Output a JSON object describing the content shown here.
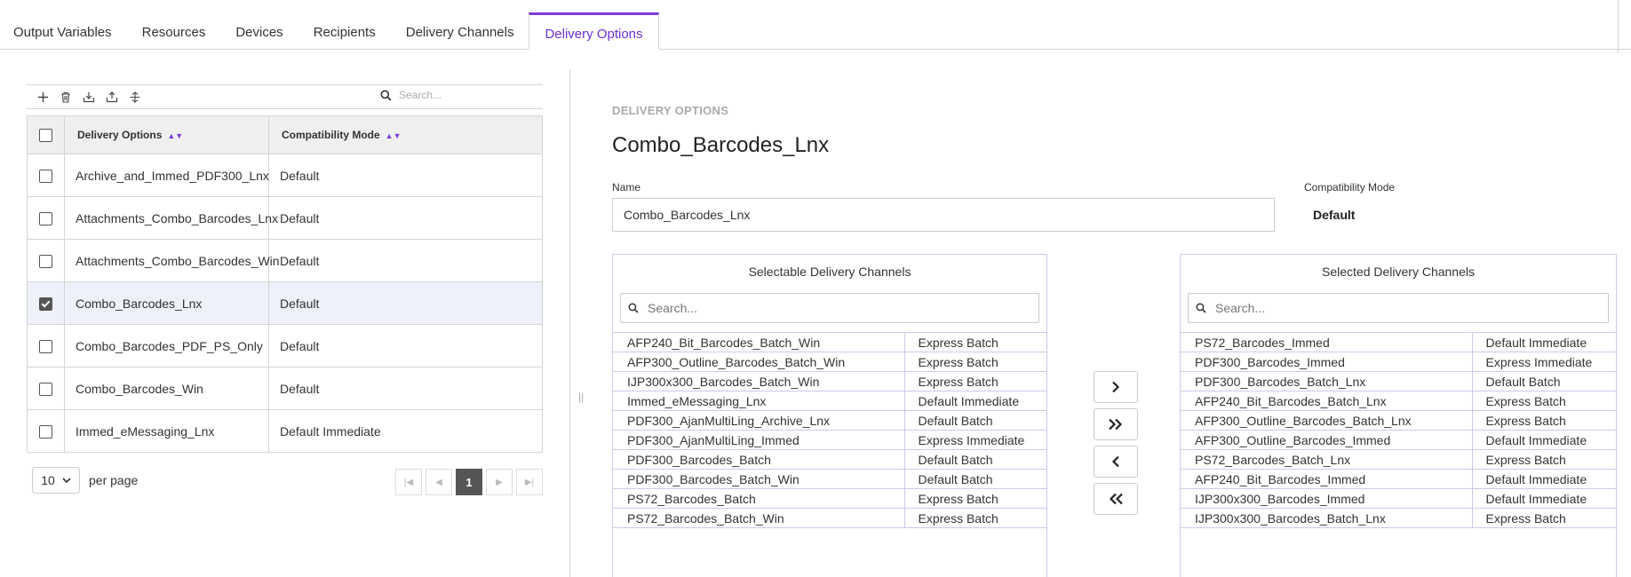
{
  "tabs": [
    {
      "label": "Output Variables",
      "active": false
    },
    {
      "label": "Resources",
      "active": false
    },
    {
      "label": "Devices",
      "active": false
    },
    {
      "label": "Recipients",
      "active": false
    },
    {
      "label": "Delivery Channels",
      "active": false
    },
    {
      "label": "Delivery Options",
      "active": true
    }
  ],
  "toolbar": {
    "icons": [
      "plus-icon",
      "trash-icon",
      "import-icon",
      "export-icon",
      "copy-icon"
    ],
    "search_placeholder": "Search..."
  },
  "table": {
    "columns": [
      "Delivery Options",
      "Compatibility Mode"
    ],
    "rows": [
      {
        "name": "Archive_and_Immed_PDF300_Lnx",
        "mode": "Default",
        "checked": false
      },
      {
        "name": "Attachments_Combo_Barcodes_Lnx",
        "mode": "Default",
        "checked": false
      },
      {
        "name": "Attachments_Combo_Barcodes_Win",
        "mode": "Default",
        "checked": false
      },
      {
        "name": "Combo_Barcodes_Lnx",
        "mode": "Default",
        "checked": true
      },
      {
        "name": "Combo_Barcodes_PDF_PS_Only",
        "mode": "Default",
        "checked": false
      },
      {
        "name": "Combo_Barcodes_Win",
        "mode": "Default",
        "checked": false
      },
      {
        "name": "Immed_eMessaging_Lnx",
        "mode": "Default Immediate",
        "checked": false
      }
    ]
  },
  "pagination": {
    "per_page": "10",
    "per_page_label": "per page",
    "current_page": "1"
  },
  "detail": {
    "section_label": "DELIVERY OPTIONS",
    "title": "Combo_Barcodes_Lnx",
    "name_label": "Name",
    "name_value": "Combo_Barcodes_Lnx",
    "compat_label": "Compatibility Mode",
    "compat_value": "Default"
  },
  "selectable": {
    "title": "Selectable Delivery Channels",
    "search_placeholder": "Search...",
    "items": [
      {
        "name": "AFP240_Bit_Barcodes_Batch_Win",
        "type": "Express Batch"
      },
      {
        "name": "AFP300_Outline_Barcodes_Batch_Win",
        "type": "Express Batch"
      },
      {
        "name": "IJP300x300_Barcodes_Batch_Win",
        "type": "Express Batch"
      },
      {
        "name": "Immed_eMessaging_Lnx",
        "type": "Default Immediate"
      },
      {
        "name": "PDF300_AjanMultiLing_Archive_Lnx",
        "type": "Default Batch"
      },
      {
        "name": "PDF300_AjanMultiLing_Immed",
        "type": "Express Immediate"
      },
      {
        "name": "PDF300_Barcodes_Batch",
        "type": "Default Batch"
      },
      {
        "name": "PDF300_Barcodes_Batch_Win",
        "type": "Default Batch"
      },
      {
        "name": "PS72_Barcodes_Batch",
        "type": "Express Batch"
      },
      {
        "name": "PS72_Barcodes_Batch_Win",
        "type": "Express Batch"
      }
    ]
  },
  "selected": {
    "title": "Selected Delivery Channels",
    "search_placeholder": "Search...",
    "items": [
      {
        "name": "PS72_Barcodes_Immed",
        "type": "Default Immediate"
      },
      {
        "name": "PDF300_Barcodes_Immed",
        "type": "Express Immediate"
      },
      {
        "name": "PDF300_Barcodes_Batch_Lnx",
        "type": "Default Batch"
      },
      {
        "name": "AFP240_Bit_Barcodes_Batch_Lnx",
        "type": "Express Batch"
      },
      {
        "name": "AFP300_Outline_Barcodes_Batch_Lnx",
        "type": "Express Batch"
      },
      {
        "name": "AFP300_Outline_Barcodes_Immed",
        "type": "Default Immediate"
      },
      {
        "name": "PS72_Barcodes_Batch_Lnx",
        "type": "Express Batch"
      },
      {
        "name": "AFP240_Bit_Barcodes_Immed",
        "type": "Default Immediate"
      },
      {
        "name": "IJP300x300_Barcodes_Immed",
        "type": "Default Immediate"
      },
      {
        "name": "IJP300x300_Barcodes_Batch_Lnx",
        "type": "Express Batch"
      }
    ]
  },
  "move_buttons": [
    "move-right-icon",
    "move-all-right-icon",
    "move-left-icon",
    "move-all-left-icon"
  ],
  "colors": {
    "accent": "#7d3bd8",
    "selected_row": "#eef0fa",
    "header_bg": "#efefef",
    "panel_border": "#c9cce8"
  }
}
